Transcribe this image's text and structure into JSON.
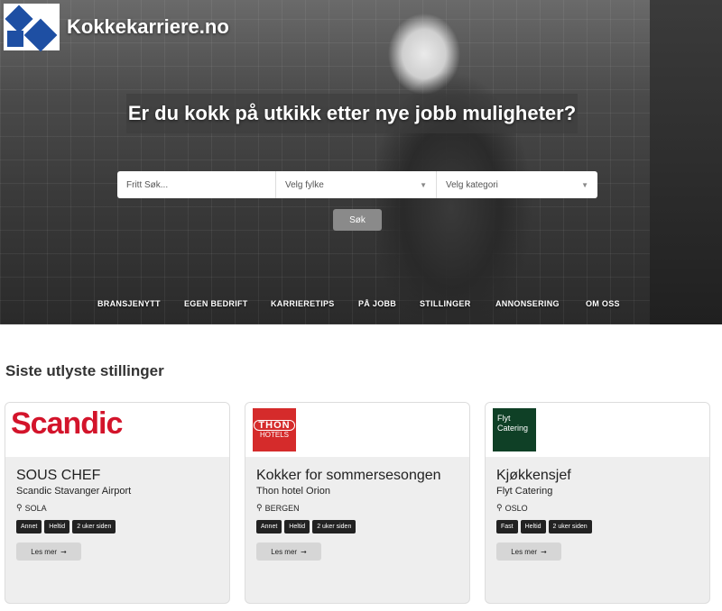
{
  "brand": {
    "name": "Kokkekarriere.no"
  },
  "hero": {
    "headline": "Er du kokk på utkikk etter nye jobb muligheter?",
    "search": {
      "free_placeholder": "Fritt Søk...",
      "county_label": "Velg fylke",
      "category_label": "Velg kategori",
      "submit_label": "Søk"
    }
  },
  "nav": {
    "items": [
      "BRANSJENYTT",
      "EGEN BEDRIFT",
      "KARRIERETIPS",
      "PÅ JOBB",
      "STILLINGER",
      "ANNONSERING",
      "OM OSS"
    ]
  },
  "section": {
    "title": "Siste utlyste stillinger"
  },
  "jobs": [
    {
      "logo_text": "Scandic",
      "title": "SOUS CHEF",
      "company": "Scandic Stavanger Airport",
      "location": "SOLA",
      "tags": [
        "Annet",
        "Heltid",
        "2 uker siden"
      ],
      "more_label": "Les mer"
    },
    {
      "logo_text": "THON",
      "logo_sub": "HOTELS",
      "title": "Kokker for sommersesongen",
      "company": "Thon hotel Orion",
      "location": "BERGEN",
      "tags": [
        "Annet",
        "Heltid",
        "2 uker siden"
      ],
      "more_label": "Les mer"
    },
    {
      "logo_text": "Flyt",
      "logo_sub": "Catering",
      "title": "Kjøkkensjef",
      "company": "Flyt Catering",
      "location": "OSLO",
      "tags": [
        "Fast",
        "Heltid",
        "2 uker siden"
      ],
      "more_label": "Les mer"
    }
  ],
  "colors": {
    "scandic_red": "#d3142b",
    "thon_red": "#d52b2b",
    "flyt_green": "#0f4026",
    "brand_blue": "#1e4fa3"
  }
}
